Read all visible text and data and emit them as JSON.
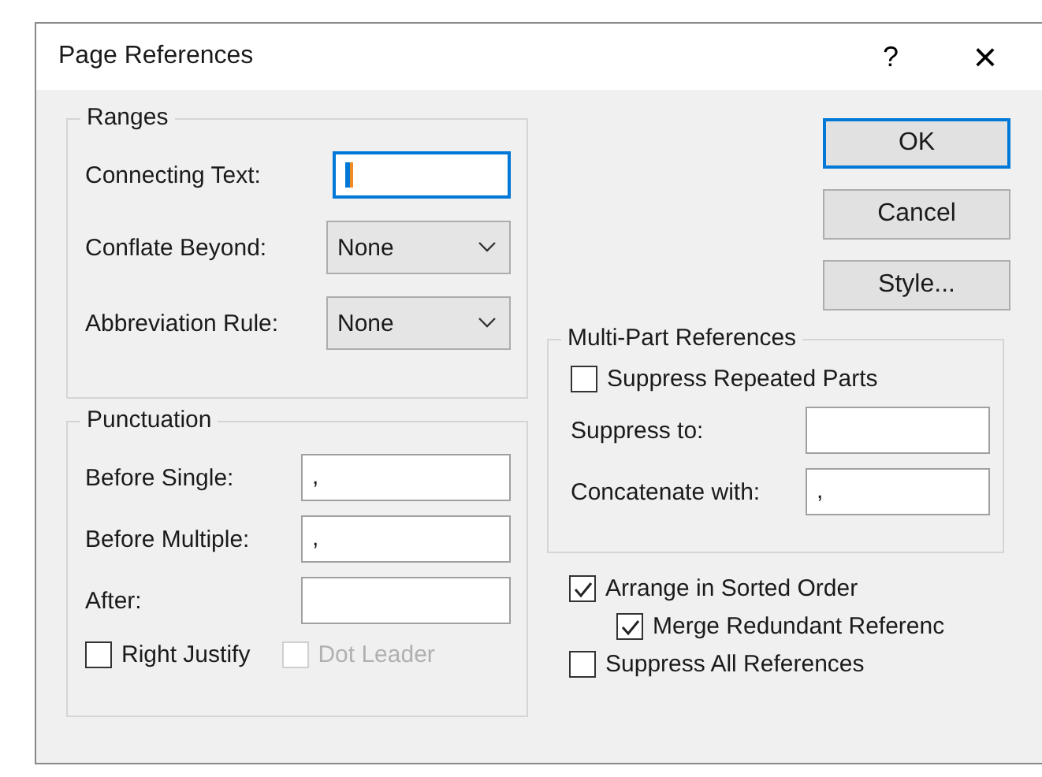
{
  "window": {
    "title": "Page References",
    "help": "?",
    "close": "×"
  },
  "ranges": {
    "title": "Ranges",
    "fields": [
      {
        "kind": "text",
        "label": "Connecting Text:",
        "focused": true
      },
      {
        "kind": "dropdown",
        "label": "Conflate Beyond:",
        "value": "None"
      },
      {
        "kind": "dropdown",
        "label": "Abbreviation Rule:",
        "value": "None"
      }
    ]
  },
  "punctuation": {
    "title": "Punctuation",
    "fields": [
      {
        "label": "Before Single:",
        "value": ","
      },
      {
        "label": "Before Multiple:",
        "value": ","
      },
      {
        "label": "After:"
      }
    ],
    "checkboxes": [
      {
        "label": "Right Justify",
        "checked": false,
        "disabled": false
      },
      {
        "label": "Dot Leader",
        "checked": false,
        "disabled": true
      }
    ]
  },
  "buttons": [
    {
      "label": "OK",
      "default": true
    },
    {
      "label": "Cancel",
      "default": false
    },
    {
      "label": "Style...",
      "default": false
    }
  ],
  "multi_part": {
    "title": "Multi-Part References",
    "checkbox": {
      "label": "Suppress Repeated Parts",
      "checked": false
    },
    "fields": [
      {
        "label": "Suppress to:"
      },
      {
        "label": "Concatenate with:",
        "value": ","
      }
    ]
  },
  "options": [
    {
      "label": "Arrange in Sorted Order",
      "checked": true,
      "children": [
        {
          "label": "Merge Redundant Referenc",
          "checked": true
        }
      ]
    },
    {
      "label": "Suppress All References",
      "checked": false
    }
  ]
}
